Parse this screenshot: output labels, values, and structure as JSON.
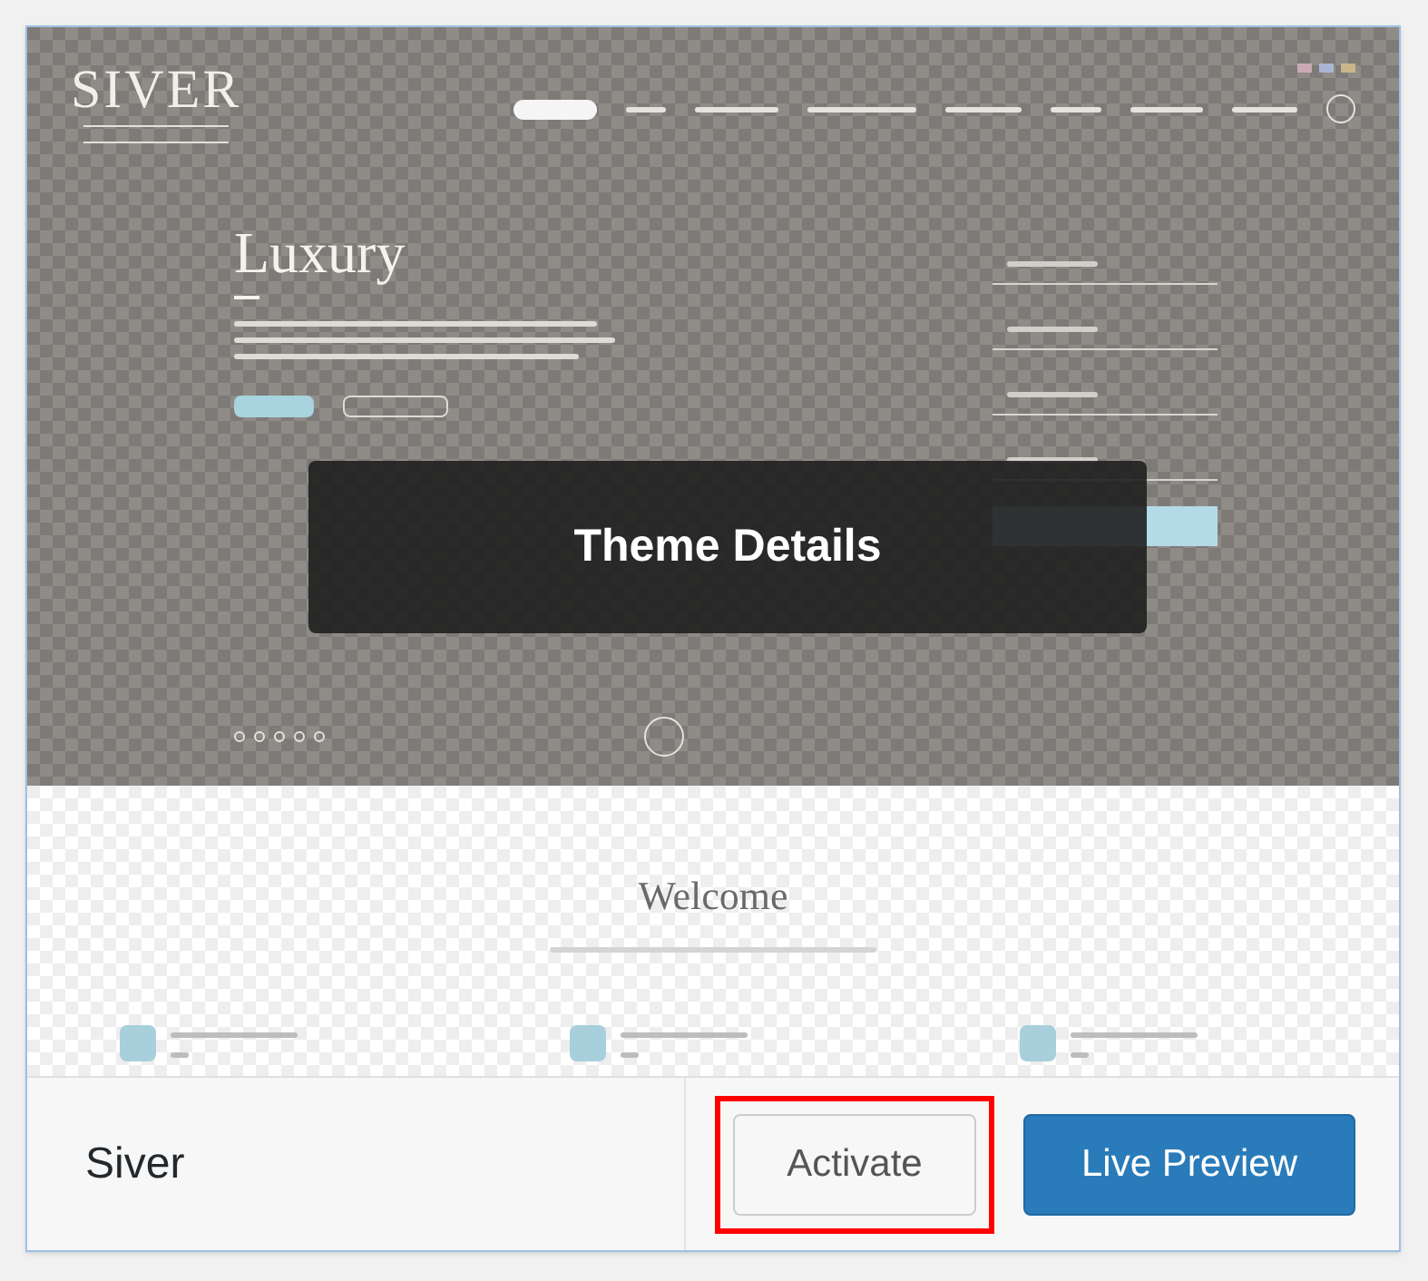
{
  "theme": {
    "name": "Siver",
    "preview": {
      "logo": "SIVER",
      "hero_title": "Luxury",
      "section_title": "Welcome"
    },
    "overlay": "Theme Details",
    "buttons": [
      {
        "label": "Activate",
        "kind": "secondary",
        "highlighted": true
      },
      {
        "label": "Live Preview",
        "kind": "primary",
        "highlighted": false
      }
    ]
  }
}
